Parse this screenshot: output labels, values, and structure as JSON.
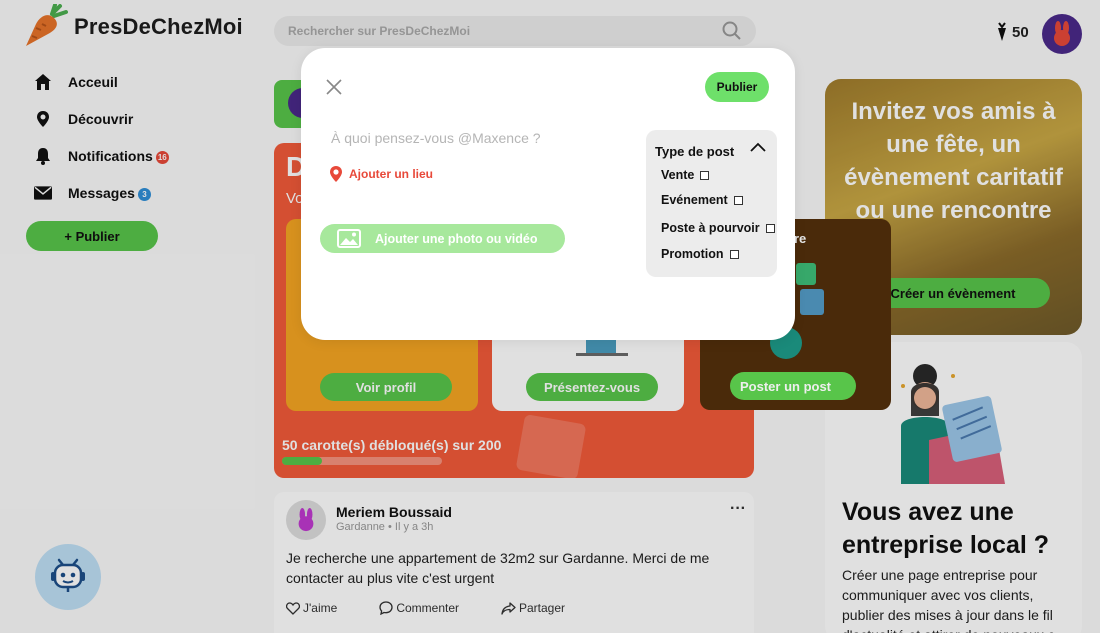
{
  "header": {
    "app_name": "PresDeChezMoi",
    "search_placeholder": "Rechercher sur PresDeChezMoi",
    "carrot_count": "50"
  },
  "nav": {
    "items": [
      {
        "label": "Acceuil",
        "icon": "home-icon"
      },
      {
        "label": "Découvrir",
        "icon": "location-pin-icon"
      },
      {
        "label": "Notifications",
        "icon": "bell-icon",
        "badge": "16",
        "badge_color": "#e8493a"
      },
      {
        "label": "Messages",
        "icon": "envelope-icon",
        "badge": "3",
        "badge_color": "#2f8fd8"
      }
    ],
    "publish_label": "+ Publier"
  },
  "promo": {
    "title": "D",
    "subtitle": "Vo",
    "cards": [
      {
        "button": "Voir profil",
        "color": "#f5a623"
      },
      {
        "button": "Présentez-vous",
        "color": "#ffffff"
      }
    ],
    "progress_text": "50 carotte(s) débloqué(s) sur 200",
    "progress_value": 0.25,
    "dark_card_label": "re",
    "dark_card_button": "Poster un post"
  },
  "post": {
    "author": "Meriem Boussaid",
    "meta": "Gardanne • Il y a 3h",
    "more": "···",
    "body": "Je recherche une appartement de 32m2 sur Gardanne. Merci de me contacter au plus vite c'est urgent",
    "actions": {
      "like": "J'aime",
      "comment": "Commenter",
      "share": "Partager"
    }
  },
  "event": {
    "text": "Invitez vos amis à une fête, un évènement caritatif ou une rencontre",
    "button": "Créer un évènement"
  },
  "business": {
    "title": "Vous avez une entreprise local ?",
    "text": "Créer une page entreprise pour communiquer avec vos clients, publier des mises à jour dans le fil d'actualité et attirer de nouveaux c"
  },
  "modal": {
    "publish_label": "Publier",
    "compose_placeholder": "À quoi pensez-vous @Maxence ?",
    "location_label": "Ajouter un lieu",
    "media_label": "Ajouter une photo ou vidéo",
    "type_header": "Type de post",
    "type_options": [
      "Vente",
      "Evénement",
      "Poste à pourvoir",
      "Promotion"
    ]
  },
  "colors": {
    "brand_green": "#58c54a",
    "promo_red": "#f25a3a",
    "location_red": "#e8493a"
  }
}
